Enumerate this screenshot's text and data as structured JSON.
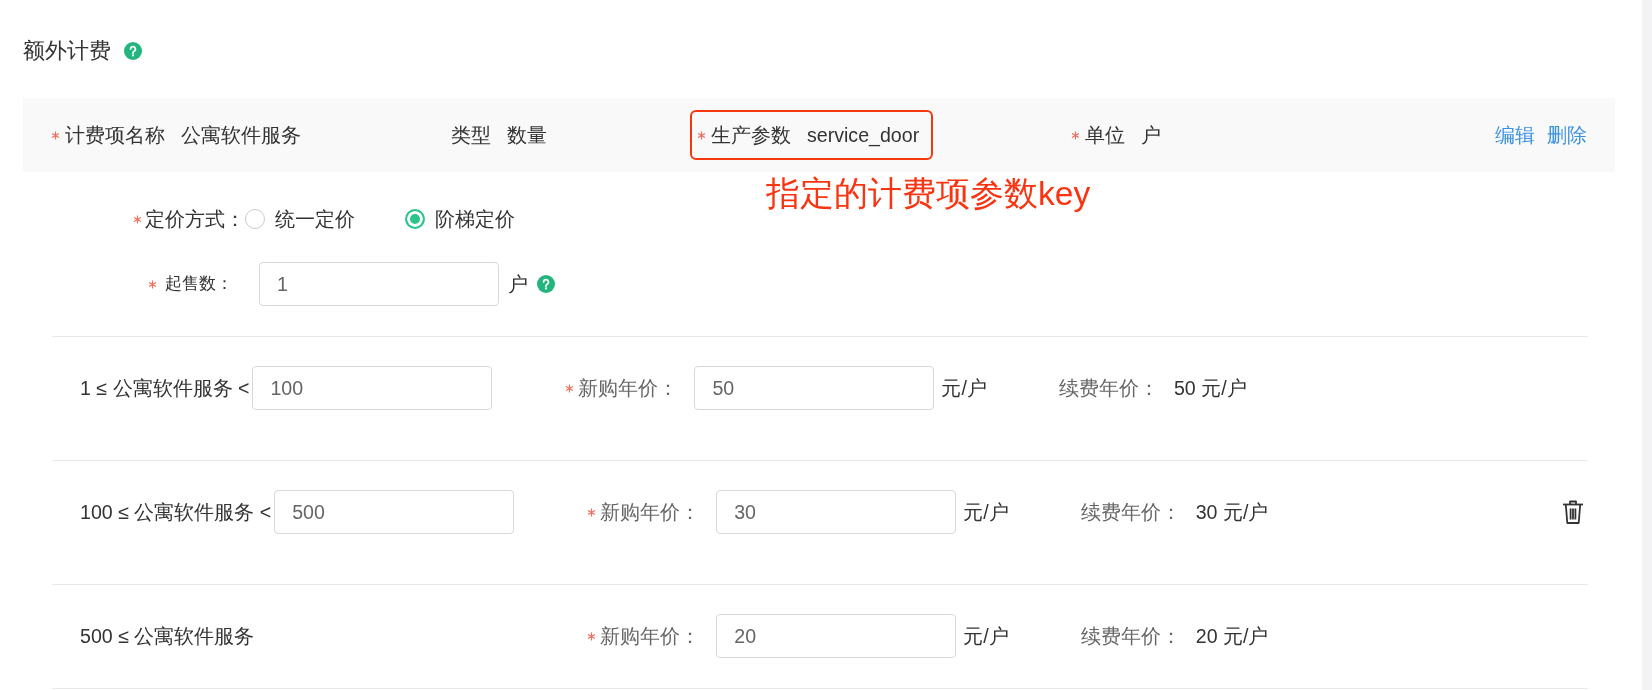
{
  "section": {
    "title": "额外计费"
  },
  "charge_item": {
    "fields": [
      {
        "label": "计费项名称",
        "value": "公寓软件服务",
        "required": true,
        "highlighted": false
      },
      {
        "label": "类型",
        "value": "数量",
        "required": false,
        "highlighted": false
      },
      {
        "label": "生产参数",
        "value": "service_door",
        "required": true,
        "highlighted": true
      },
      {
        "label": "单位",
        "value": "户",
        "required": true,
        "highlighted": false
      }
    ],
    "actions": [
      "编辑",
      "删除"
    ]
  },
  "annotation": {
    "text": "指定的计费项参数key"
  },
  "pricing_method": {
    "label": "定价方式：",
    "required": true,
    "options": [
      {
        "label": "统一定价",
        "selected": false
      },
      {
        "label": "阶梯定价",
        "selected": true
      }
    ]
  },
  "min_quantity": {
    "label": "起售数：",
    "required": true,
    "value": "1",
    "unit": "户"
  },
  "tiers": [
    {
      "range_label": "1 ≤ 公寓软件服务 <",
      "upper_limit": "100",
      "price_label": "新购年价：",
      "required": true,
      "price": "50",
      "price_unit": "元/户",
      "renewal_label": "续费年价：",
      "renewal_price": "50 元/户",
      "deletable": false
    },
    {
      "range_label": "100 ≤ 公寓软件服务 <",
      "upper_limit": "500",
      "price_label": "新购年价：",
      "required": true,
      "price": "30",
      "price_unit": "元/户",
      "renewal_label": "续费年价：",
      "renewal_price": "30 元/户",
      "deletable": true
    },
    {
      "range_label": "500 ≤ 公寓软件服务",
      "price_label": "新购年价：",
      "required": true,
      "price": "20",
      "price_unit": "元/户",
      "renewal_label": "续费年价：",
      "renewal_price": "20 元/户",
      "deletable": false
    }
  ]
}
